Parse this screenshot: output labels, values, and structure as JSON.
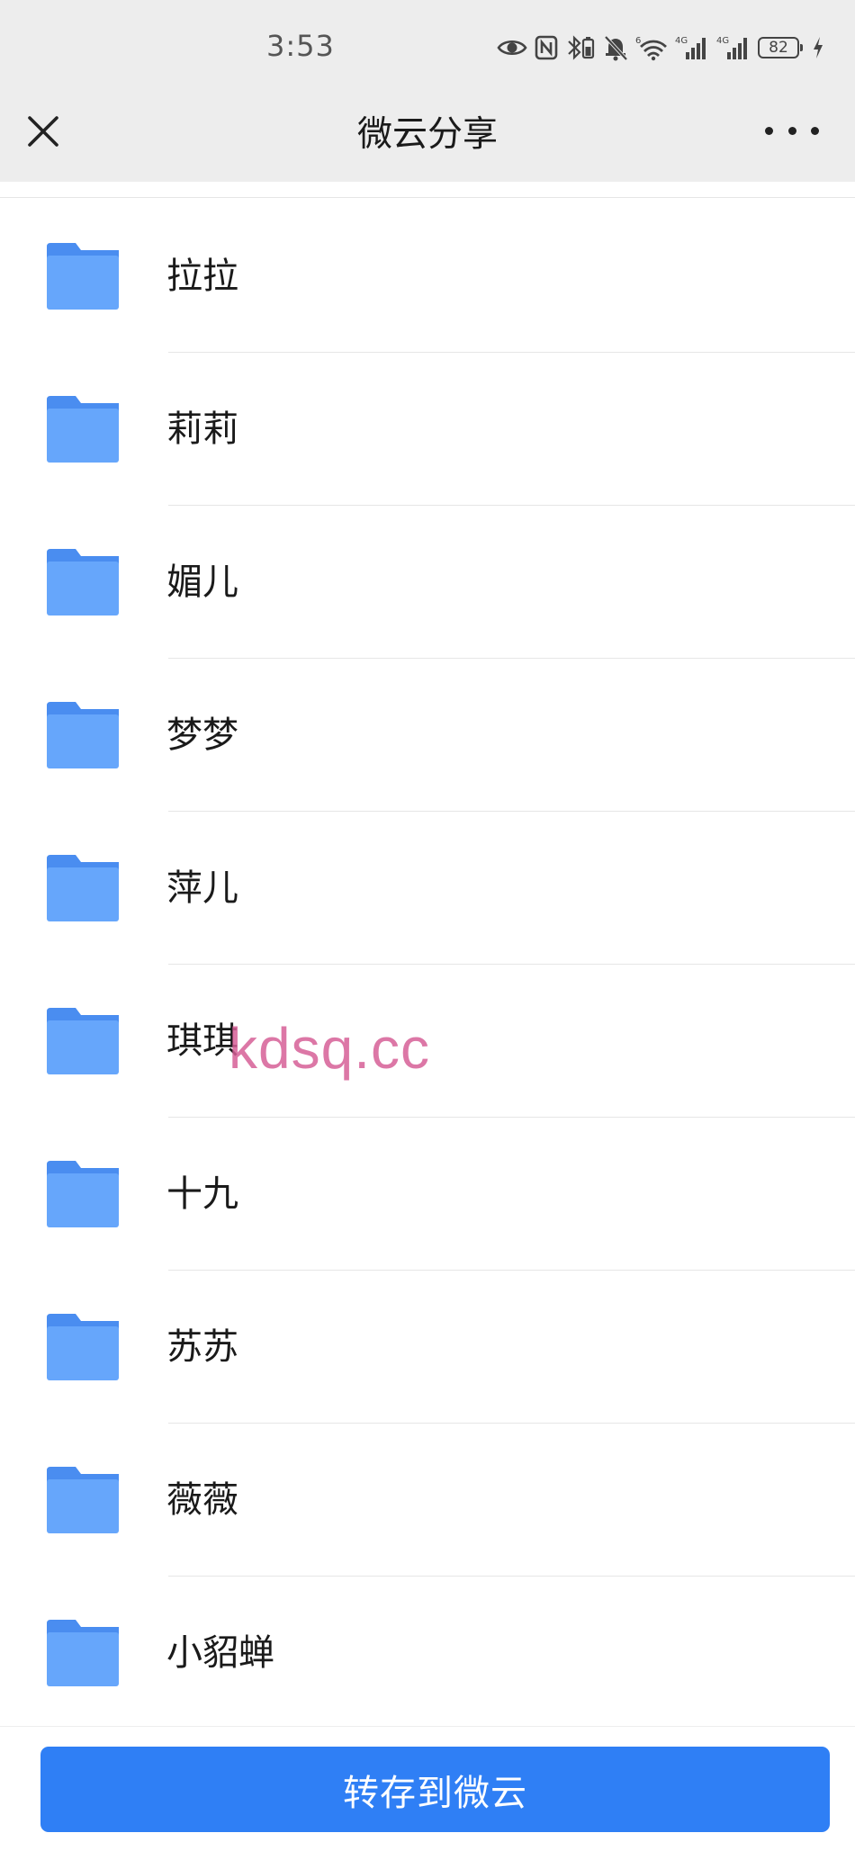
{
  "status_bar": {
    "time": "3:53",
    "battery_level": "82",
    "icons": [
      "eye-icon",
      "nfc-icon",
      "bluetooth-battery-icon",
      "mute-bell-icon",
      "wifi-6-icon",
      "signal-4g-icon",
      "signal-4g-icon",
      "battery-icon",
      "charging-bolt-icon"
    ],
    "signal_label_1": "4G",
    "signal_label_2": "4G",
    "wifi_label": "6"
  },
  "nav": {
    "title": "微云分享",
    "close_icon": "close-icon",
    "more_icon": "more-icon"
  },
  "folders": [
    {
      "name": "拉拉"
    },
    {
      "name": "莉莉"
    },
    {
      "name": "媚儿"
    },
    {
      "name": "梦梦"
    },
    {
      "name": "萍儿"
    },
    {
      "name": "琪琪"
    },
    {
      "name": "十九"
    },
    {
      "name": "苏苏"
    },
    {
      "name": "薇薇"
    },
    {
      "name": "小貂蝉"
    }
  ],
  "watermark": "kdsq.cc",
  "bottom": {
    "save_label": "转存到微云"
  },
  "colors": {
    "folder_blue": "#66a6fb",
    "folder_tab": "#4a8df0",
    "button_blue": "#2f7ff5",
    "watermark_pink": "#d65f96"
  }
}
